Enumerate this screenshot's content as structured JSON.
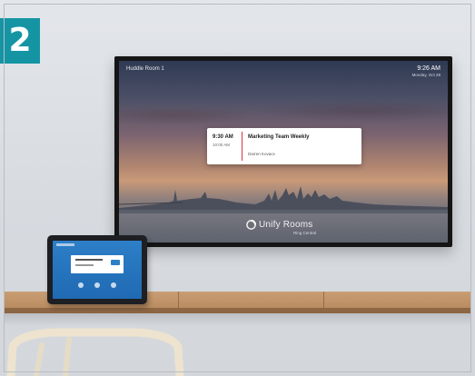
{
  "step_badge": {
    "number": "2",
    "color": "#1595a4"
  },
  "tv": {
    "room_name": "Huddle Room 1",
    "time": "9:26 AM",
    "date": "Monday, Oct 28",
    "meeting": {
      "start_time": "9:30 AM",
      "end_time": "10:00 AM",
      "title": "Marketing Team Weekly",
      "organizer": "Darren Kovacs"
    },
    "brand": {
      "name": "Unify Rooms",
      "subtitle": "Ring Central"
    },
    "colors": {
      "meeting_accent": "#d9363e"
    }
  },
  "tablet": {
    "screen_color": "#2d7fc8"
  },
  "icons": [
    "unify-logo-icon"
  ]
}
